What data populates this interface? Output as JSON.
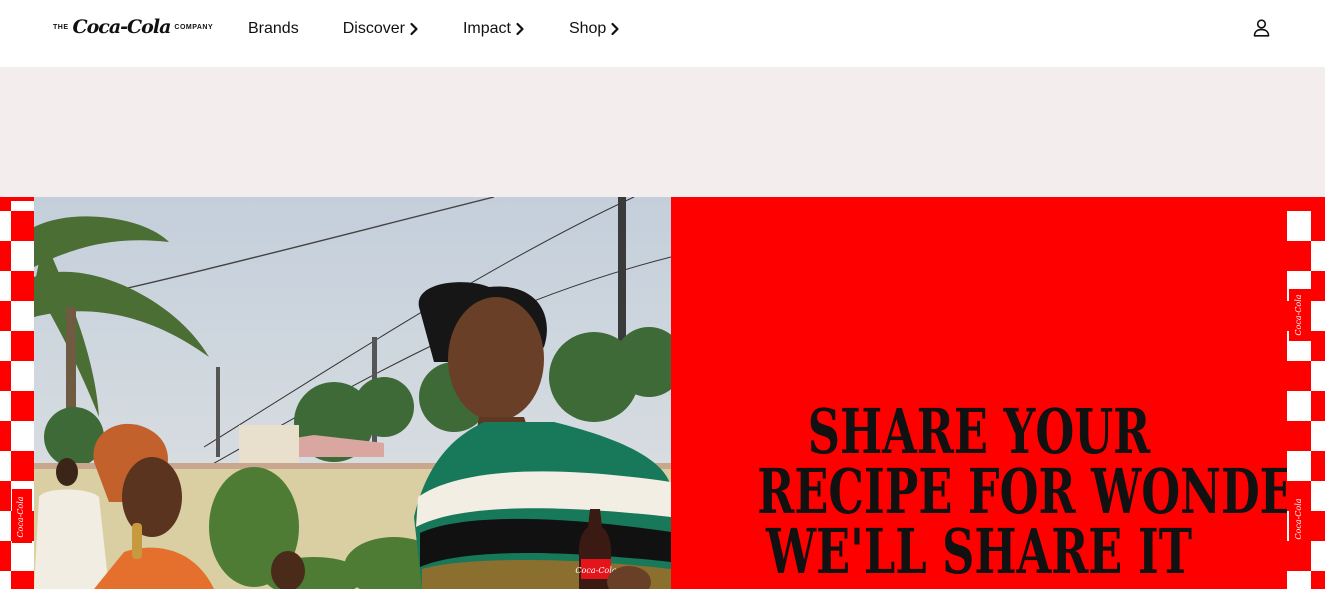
{
  "header": {
    "logo": {
      "prefix": "THE",
      "script": "Coca-Cola",
      "suffix": "COMPANY"
    },
    "nav": [
      {
        "label": "Brands",
        "has_chevron": false
      },
      {
        "label": "Discover",
        "has_chevron": true
      },
      {
        "label": "Impact",
        "has_chevron": true
      },
      {
        "label": "Shop",
        "has_chevron": true
      }
    ],
    "account_icon": "user-icon"
  },
  "hero": {
    "headline": [
      "SHARE YOUR",
      "RECIPE FOR WONDER.",
      "WE'LL SHARE IT"
    ],
    "border_mark": "Coca-Cola",
    "colors": {
      "red": "#ff0000",
      "band": "#f3eeed",
      "text": "#111111"
    }
  }
}
